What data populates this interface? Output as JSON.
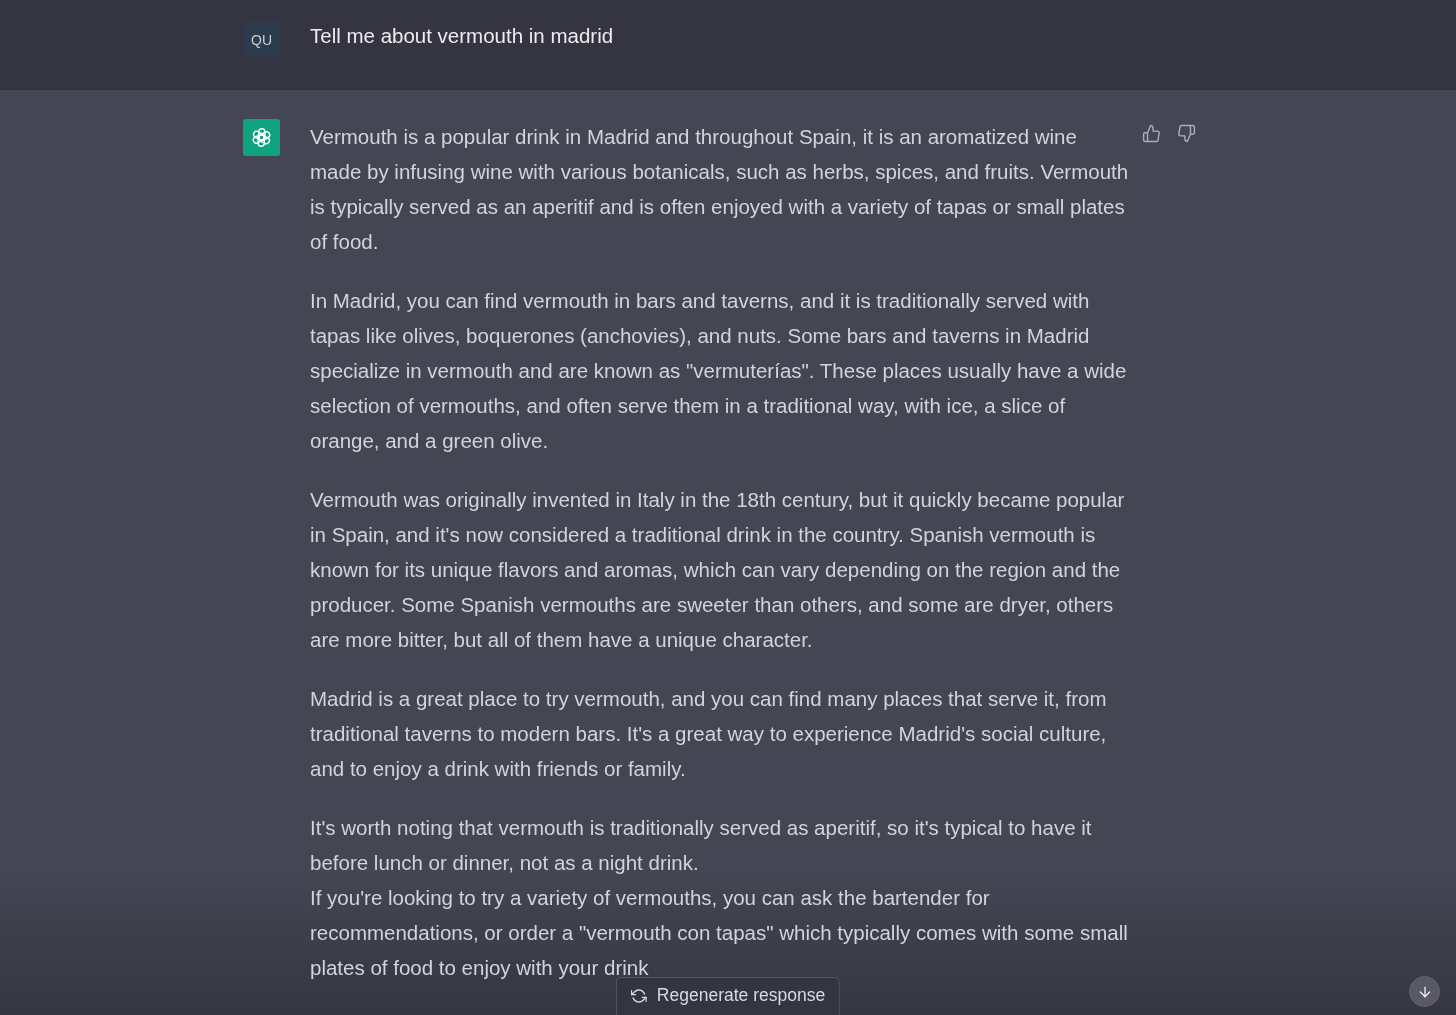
{
  "user_message": {
    "avatar": "QU",
    "text": "Tell me about vermouth in madrid"
  },
  "response": {
    "paragraphs": [
      [
        "Vermouth is a popular drink in Madrid and throughout Spain, it is an aromatized wine made by infusing wine with various botanicals, such as herbs, spices, and fruits. Vermouth is typically served as an aperitif and is often enjoyed with a variety of tapas or small plates of food."
      ],
      [
        "In Madrid, you can find vermouth in bars and taverns, and it is traditionally served with tapas like olives, boquerones (anchovies), and nuts. Some bars and taverns in Madrid specialize in vermouth and are known as \"vermuterías\". These places usually have a wide selection of vermouths, and often serve them in a traditional way, with ice, a slice of orange, and a green olive."
      ],
      [
        "Vermouth was originally invented in Italy in the 18th century, but it quickly became popular in Spain, and it's now considered a traditional drink in the country. Spanish vermouth is known for its unique flavors and aromas, which can vary depending on the region and the producer. Some Spanish vermouths are sweeter than others, and some are dryer, others are more bitter, but all of them have a unique character."
      ],
      [
        "Madrid is a great place to try vermouth, and you can find many places that serve it, from traditional taverns to modern bars. It's a great way to experience Madrid's social culture, and to enjoy a drink with friends or family."
      ],
      [
        "It's worth noting that vermouth is traditionally served as aperitif, so it's typical to have it before lunch or dinner, not as a night drink.",
        "If you're looking to try a variety of vermouths, you can ask the bartender for recommendations, or order a \"vermouth con tapas\" which typically comes with some small plates of food to enjoy with your drink"
      ]
    ]
  },
  "regenerate_button": {
    "label": "Regenerate response"
  }
}
